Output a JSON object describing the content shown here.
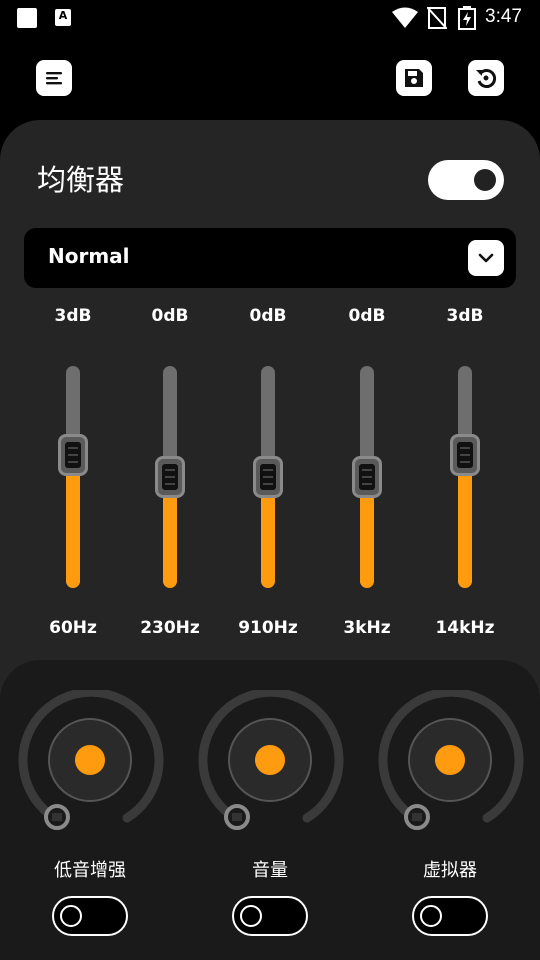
{
  "status_bar": {
    "time": "3:47",
    "left_icons": [
      "square-icon",
      "a-icon"
    ],
    "right_icons": [
      "wifi-icon",
      "no-signal-icon",
      "battery-charging-icon"
    ]
  },
  "header": {
    "menu_icon": "menu-icon",
    "save_icon": "save-icon",
    "reset_icon": "reset-icon"
  },
  "equalizer": {
    "title": "均衡器",
    "enabled": true,
    "preset": "Normal",
    "bands": [
      {
        "gain": "3dB",
        "freq": "60Hz",
        "level": 0.6
      },
      {
        "gain": "0dB",
        "freq": "230Hz",
        "level": 0.5
      },
      {
        "gain": "0dB",
        "freq": "910Hz",
        "level": 0.5
      },
      {
        "gain": "0dB",
        "freq": "3kHz",
        "level": 0.5
      },
      {
        "gain": "3dB",
        "freq": "14kHz",
        "level": 0.6
      }
    ]
  },
  "effects": [
    {
      "label": "低音增强",
      "enabled": false
    },
    {
      "label": "音量",
      "enabled": false
    },
    {
      "label": "虚拟器",
      "enabled": false
    }
  ],
  "colors": {
    "accent": "#ff9b0f",
    "panel": "#252526",
    "background": "#000000"
  }
}
